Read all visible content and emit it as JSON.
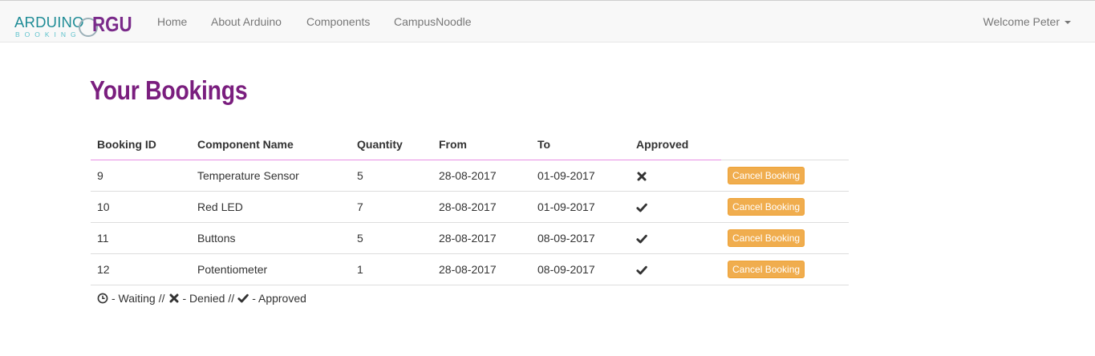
{
  "brand": {
    "arduino": "ARDUINO",
    "booking": "BOOKING",
    "rgu": "RGU"
  },
  "nav": {
    "home": "Home",
    "about": "About Arduino",
    "components": "Components",
    "campus": "CampusNoodle",
    "welcome": "Welcome Peter"
  },
  "page": {
    "title": "Your Bookings"
  },
  "table": {
    "headers": [
      "Booking ID",
      "Component Name",
      "Quantity",
      "From",
      "To",
      "Approved"
    ],
    "rows": [
      {
        "id": "9",
        "component": "Temperature Sensor",
        "quantity": "5",
        "from": "28-08-2017",
        "to": "01-09-2017",
        "approved": "denied-icon",
        "action": "Cancel Booking"
      },
      {
        "id": "10",
        "component": "Red LED",
        "quantity": "7",
        "from": "28-08-2017",
        "to": "01-09-2017",
        "approved": "approved-icon",
        "action": "Cancel Booking"
      },
      {
        "id": "11",
        "component": "Buttons",
        "quantity": "5",
        "from": "28-08-2017",
        "to": "08-09-2017",
        "approved": "approved-icon",
        "action": "Cancel Booking"
      },
      {
        "id": "12",
        "component": "Potentiometer",
        "quantity": "1",
        "from": "28-08-2017",
        "to": "08-09-2017",
        "approved": "approved-icon",
        "action": "Cancel Booking"
      }
    ]
  },
  "legend": {
    "waiting": "- Waiting",
    "separator": "//",
    "denied": "- Denied",
    "approved": "- Approved"
  },
  "colors": {
    "brand_purple": "#7a1e7e",
    "brand_teal": "#1f8c96",
    "button_warning": "#f0ad4e",
    "header_underline": "#e88fe4"
  }
}
